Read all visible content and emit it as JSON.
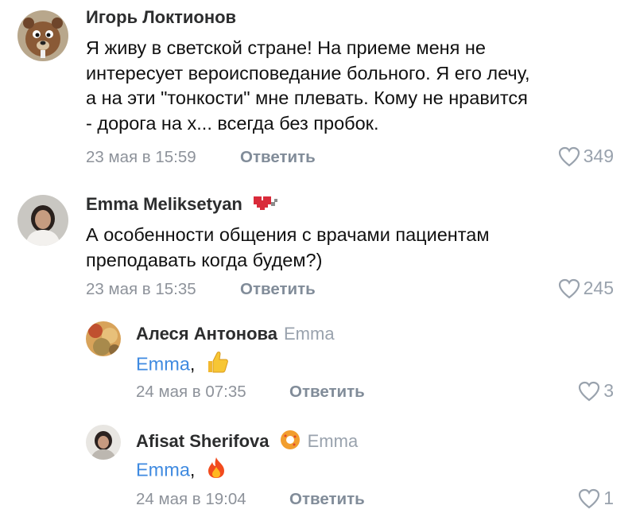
{
  "comments": [
    {
      "author": "Игорь Локтионов",
      "text_lines": [
        "Я живу в светской стране! На приеме меня не",
        "интересует вероисповедание больного. Я его лечу,",
        "а на эти \"тонкости\" мне плевать. Кому не нравится",
        "- дорога на х... всегда без пробок."
      ],
      "date": "23 мая в 15:59",
      "reply_label": "Ответить",
      "likes": "349",
      "avatar_icon": "bear-avatar-icon"
    },
    {
      "author": "Emma Meliksetyan",
      "text_lines": [
        "А особенности общения с врачами пациентам",
        "преподавать когда будем?)"
      ],
      "date": "23 мая в 15:35",
      "reply_label": "Ответить",
      "likes": "245",
      "badge_icon": "pixel-heart-badge-icon"
    }
  ],
  "replies": [
    {
      "author": "Алеся Антонова",
      "reply_to": "Emma",
      "mention": "Emma",
      "suffix": ",",
      "emoji_icon": "thumbs-up-emoji-icon",
      "date": "24 мая в 07:35",
      "reply_label": "Ответить",
      "likes": "3"
    },
    {
      "author": "Afisat Sherifova",
      "reply_to": "Emma",
      "mention": "Emma",
      "suffix": ",",
      "emoji_icon": "fire-emoji-icon",
      "badge_icon": "orange-donut-badge-icon",
      "date": "24 мая в 19:04",
      "reply_label": "Ответить",
      "likes": "1"
    }
  ],
  "colors": {
    "link": "#3f8ae0",
    "meta": "#8d929a",
    "heart": "#99a2ad"
  }
}
